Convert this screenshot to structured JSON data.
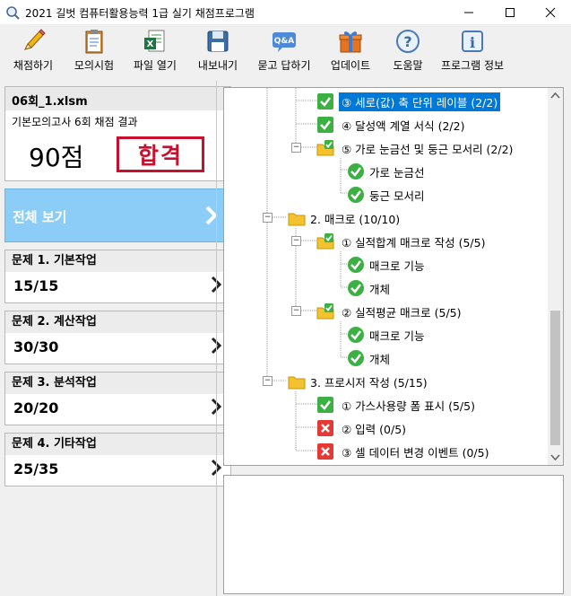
{
  "window": {
    "title": "2021 길벗 컴퓨터활용능력 1급 실기 채점프로그램"
  },
  "toolbar": [
    {
      "label": "채점하기",
      "icon": "pencil-icon"
    },
    {
      "label": "모의시험",
      "icon": "clipboard-icon"
    },
    {
      "label": "파일 열기",
      "icon": "excel-file-icon"
    },
    {
      "label": "내보내기",
      "icon": "floppy-disk-icon"
    },
    {
      "label": "묻고 답하기",
      "icon": "qa-bubble-icon"
    },
    {
      "label": "업데이트",
      "icon": "gift-box-icon"
    },
    {
      "label": "도움말",
      "icon": "help-icon"
    },
    {
      "label": "프로그램 정보",
      "icon": "info-icon"
    }
  ],
  "result": {
    "filename": "06회_1.xlsm",
    "description": "기본모의고사 6회 채점 결과",
    "score": "90점",
    "stamp": "합격"
  },
  "view_all": {
    "label": "전체 보기"
  },
  "problems": [
    {
      "title": "문제 1. 기본작업",
      "score": "15/15"
    },
    {
      "title": "문제 2. 계산작업",
      "score": "30/30"
    },
    {
      "title": "문제 3. 분석작업",
      "score": "20/20"
    },
    {
      "title": "문제 4. 기타작업",
      "score": "25/35"
    }
  ],
  "tree": [
    {
      "label": "③ 세로(값) 축 단위 레이블 (2/2)",
      "status": "pass",
      "selected": true
    },
    {
      "label": "④ 달성액 계열 서식 (2/2)",
      "status": "pass"
    },
    {
      "label": "⑤ 가로 눈금선 및 둥근 모서리 (2/2)",
      "status": "folder-pass"
    },
    {
      "label": "가로 눈금선",
      "status": "circle-pass"
    },
    {
      "label": "둥근 모서리",
      "status": "circle-pass"
    },
    {
      "label": "2. 매크로 (10/10)",
      "status": "folder"
    },
    {
      "label": "① 실적합계 매크로 작성 (5/5)",
      "status": "folder-pass"
    },
    {
      "label": "매크로 기능",
      "status": "circle-pass"
    },
    {
      "label": "개체",
      "status": "circle-pass"
    },
    {
      "label": "② 실적평균 매크로 (5/5)",
      "status": "folder-pass"
    },
    {
      "label": "매크로 기능",
      "status": "circle-pass"
    },
    {
      "label": "개체",
      "status": "circle-pass"
    },
    {
      "label": "3. 프로시저 작성 (5/15)",
      "status": "folder"
    },
    {
      "label": "① 가스사용량 폼 표시 (5/5)",
      "status": "pass"
    },
    {
      "label": "② 입력 (0/5)",
      "status": "fail"
    },
    {
      "label": "③ 셀 데이터 변경 이벤트 (0/5)",
      "status": "fail"
    }
  ],
  "colors": {
    "accent": "#8ccdf7",
    "stamp": "#c8102e",
    "pass": "#3cb043",
    "fail": "#e53935",
    "select": "#0078d7"
  }
}
